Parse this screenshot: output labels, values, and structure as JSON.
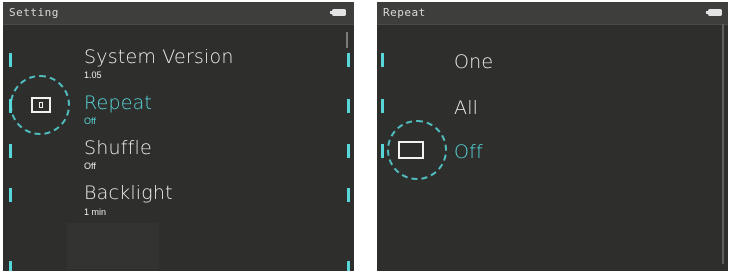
{
  "settings": {
    "title": "Setting",
    "items": [
      {
        "label": "System Version",
        "value": "1.05"
      },
      {
        "label": "Repeat",
        "value": "Off"
      },
      {
        "label": "Shuffle",
        "value": "Off"
      },
      {
        "label": "Backlight",
        "value": "1 min"
      }
    ],
    "selected_icon": "repeat-icon"
  },
  "repeat": {
    "title": "Repeat",
    "options": [
      "One",
      "All",
      "Off"
    ],
    "selected": "Off",
    "selected_icon": "repeat-off-icon"
  },
  "colors": {
    "accent": "#57d7d9",
    "background": "#2e2f2d",
    "text": "#ececec"
  }
}
